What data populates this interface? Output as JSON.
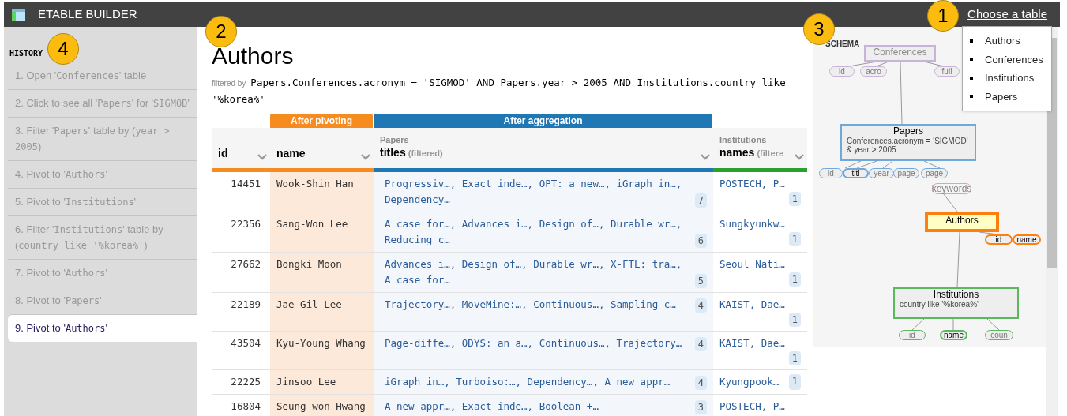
{
  "app": {
    "title": "ETABLE BUILDER",
    "menu_link": "Choose a table"
  },
  "table_menu": {
    "items": [
      "Authors",
      "Conferences",
      "Institutions",
      "Papers"
    ]
  },
  "history": {
    "title": "HISTORY",
    "items": [
      {
        "selected": false,
        "parts": [
          {
            "kind": "text",
            "text": "1. Open '"
          },
          {
            "kind": "code",
            "text": "Conferences"
          },
          {
            "kind": "text",
            "text": "' table"
          }
        ]
      },
      {
        "selected": false,
        "parts": [
          {
            "kind": "text",
            "text": "2. Click to see all '"
          },
          {
            "kind": "code",
            "text": "Papers"
          },
          {
            "kind": "text",
            "text": "' for '"
          },
          {
            "kind": "code",
            "text": "SIGMOD"
          },
          {
            "kind": "text",
            "text": "'"
          }
        ]
      },
      {
        "selected": false,
        "parts": [
          {
            "kind": "text",
            "text": "3. Filter '"
          },
          {
            "kind": "code",
            "text": "Papers"
          },
          {
            "kind": "text",
            "text": "' table by ("
          },
          {
            "kind": "code",
            "text": "year > 2005"
          },
          {
            "kind": "text",
            "text": ")"
          }
        ]
      },
      {
        "selected": false,
        "parts": [
          {
            "kind": "text",
            "text": "4. Pivot to '"
          },
          {
            "kind": "code",
            "text": "Authors"
          },
          {
            "kind": "text",
            "text": "'"
          }
        ]
      },
      {
        "selected": false,
        "parts": [
          {
            "kind": "text",
            "text": "5. Pivot to '"
          },
          {
            "kind": "code",
            "text": "Institutions"
          },
          {
            "kind": "text",
            "text": "'"
          }
        ]
      },
      {
        "selected": false,
        "parts": [
          {
            "kind": "text",
            "text": "6. Filter '"
          },
          {
            "kind": "code",
            "text": "Institutions"
          },
          {
            "kind": "text",
            "text": "' table by ("
          },
          {
            "kind": "code",
            "text": "country like '%korea%'"
          },
          {
            "kind": "text",
            "text": ")"
          }
        ]
      },
      {
        "selected": false,
        "parts": [
          {
            "kind": "text",
            "text": "7. Pivot to '"
          },
          {
            "kind": "code",
            "text": "Authors"
          },
          {
            "kind": "text",
            "text": "'"
          }
        ]
      },
      {
        "selected": false,
        "parts": [
          {
            "kind": "text",
            "text": "8. Pivot to '"
          },
          {
            "kind": "code",
            "text": "Papers"
          },
          {
            "kind": "text",
            "text": "'"
          }
        ]
      },
      {
        "selected": true,
        "parts": [
          {
            "kind": "text",
            "text": "9. Pivot to '"
          },
          {
            "kind": "code",
            "text": "Authors"
          },
          {
            "kind": "text",
            "text": "'"
          }
        ]
      }
    ]
  },
  "view": {
    "title": "Authors",
    "filter_label": "filtered by",
    "filter": "Papers.Conferences.acronym = 'SIGMOD' AND Papers.year > 2005 AND Institutions.country like '%korea%'"
  },
  "table": {
    "columns": [
      {
        "label": "id",
        "kind": "key",
        "color": "#f68b1f"
      },
      {
        "label": "name",
        "kind": "pivoted",
        "color": "#f68b1f",
        "band": {
          "label": "After pivoting",
          "color": "#f68b1f"
        }
      },
      {
        "label": "titles",
        "source": "Papers",
        "note": "(filtered)",
        "kind": "aggregated",
        "color": "#1f77b4",
        "band": {
          "label": "After aggregation",
          "color": "#1f77b4"
        }
      },
      {
        "label": "names",
        "source": "Institutions",
        "note": "(filtere",
        "kind": "joined",
        "color": "#2ca02c"
      }
    ],
    "rows": [
      [
        {
          "text": "14451"
        },
        {
          "text": "Wook-Shin Han"
        },
        {
          "text": "Progressiv…, Exact inde…, OPT: a new…, iGraph in…, Dependency…",
          "count": "7"
        },
        {
          "text": "POSTECH, P…",
          "count": "1"
        }
      ],
      [
        {
          "text": "22356"
        },
        {
          "text": "Sang-Won Lee"
        },
        {
          "text": "A case for…, Advances i…, Design of…, Durable wr…, Reducing c…",
          "count": "6"
        },
        {
          "text": "Sungkyunkw…",
          "count": "1"
        }
      ],
      [
        {
          "text": "27662"
        },
        {
          "text": "Bongki Moon"
        },
        {
          "text": "Advances i…, Design of…, Durable wr…, X-FTL: tra…, A case for…",
          "count": "5"
        },
        {
          "text": "Seoul Nati…",
          "count": "1"
        }
      ],
      [
        {
          "text": "22189"
        },
        {
          "text": "Jae-Gil Lee"
        },
        {
          "text": "Trajectory…, MoveMine:…, Continuous…, Sampling c…",
          "count": "4"
        },
        {
          "text": "KAIST, Dae…",
          "count": "1"
        }
      ],
      [
        {
          "text": "43504"
        },
        {
          "text": "Kyu-Young Whang"
        },
        {
          "text": "Page-diffe…, ODYS: an a…, Continuous…, Trajectory…",
          "count": "4"
        },
        {
          "text": "KAIST, Dae…",
          "count": "1"
        }
      ],
      [
        {
          "text": "22225"
        },
        {
          "text": "Jinsoo Lee"
        },
        {
          "text": "iGraph in…, Turboiso:…, Dependency…, A new appr…",
          "count": "4"
        },
        {
          "text": "Kyungpook…",
          "count": "1"
        }
      ],
      [
        {
          "text": "16804"
        },
        {
          "text": "Seung-won Hwang"
        },
        {
          "text": "A new appr…, Exact inde…, Boolean +…",
          "count": "3"
        },
        {
          "text": "POSTECH, P…"
        }
      ]
    ]
  },
  "schema": {
    "title": "SCHEMA",
    "tables": [
      {
        "name": "Conferences",
        "kind": "table",
        "color": "#c9b3d9",
        "faded": true,
        "selected": false,
        "fields": [
          {
            "label": "id",
            "highlighted": false
          },
          {
            "label": "acro",
            "highlighted": false
          },
          {
            "label": "full",
            "highlighted": false
          }
        ]
      },
      {
        "name": "Papers",
        "kind": "table",
        "color": "#6fa8dc",
        "faded": false,
        "selected": false,
        "filter": "Conferences.acronym = 'SIGMOD' & year > 2005",
        "fields": [
          {
            "label": "id",
            "highlighted": false
          },
          {
            "label": "titl",
            "highlighted": true
          },
          {
            "label": "year",
            "highlighted": false
          },
          {
            "label": "page",
            "highlighted": false
          },
          {
            "label": "page",
            "highlighted": false
          }
        ]
      },
      {
        "name": "keywords",
        "kind": "stub",
        "color": "#e8a0a8",
        "faded": true,
        "selected": false
      },
      {
        "name": "Authors",
        "kind": "table",
        "color": "#ff7f0e",
        "faded": false,
        "selected": true,
        "fields": [
          {
            "label": "id",
            "highlighted": true
          },
          {
            "label": "name",
            "highlighted": true
          }
        ]
      },
      {
        "name": "Institutions",
        "kind": "table",
        "color": "#5cb85c",
        "faded": false,
        "selected": false,
        "filter": "country like '%korea%'",
        "fields": [
          {
            "label": "id",
            "highlighted": false
          },
          {
            "label": "name",
            "highlighted": true
          },
          {
            "label": "coun",
            "highlighted": false
          }
        ]
      }
    ]
  },
  "callouts": [
    {
      "label": "1"
    },
    {
      "label": "2"
    },
    {
      "label": "3"
    },
    {
      "label": "4"
    }
  ]
}
